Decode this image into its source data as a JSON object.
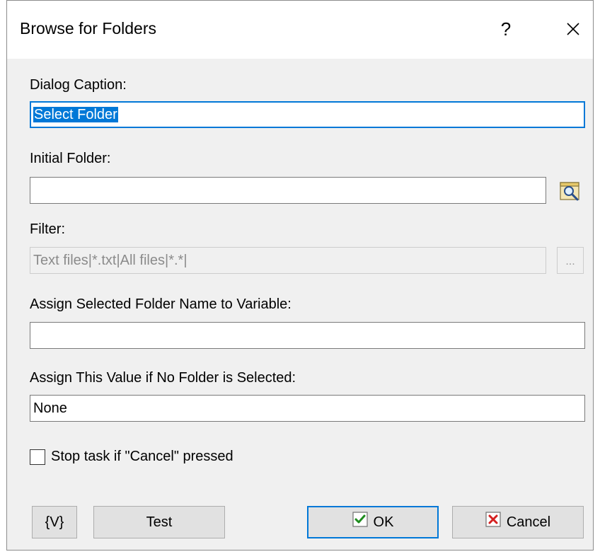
{
  "window": {
    "title": "Browse for Folders",
    "help_label": "?",
    "close_icon": "close-icon"
  },
  "fields": {
    "dialog_caption": {
      "label": "Dialog Caption:",
      "value": "Select Folder"
    },
    "initial_folder": {
      "label": "Initial Folder:",
      "value": "",
      "browse_icon": "browse-folder-icon"
    },
    "filter": {
      "label": "Filter:",
      "value": "Text files|*.txt|All files|*.*|",
      "button_label": "...",
      "disabled": true
    },
    "assign_variable": {
      "label": "Assign Selected Folder Name to Variable:",
      "value": ""
    },
    "no_folder_value": {
      "label": "Assign This Value if No Folder is Selected:",
      "value": "None"
    }
  },
  "options": {
    "stop_task_label": "Stop task if \"Cancel\" pressed",
    "stop_task_checked": false
  },
  "buttons": {
    "variables_label": "{V}",
    "test_label": "Test",
    "ok_label": "OK",
    "cancel_label": "Cancel",
    "ok_icon": "check-icon",
    "cancel_icon": "x-icon"
  },
  "colors": {
    "accent": "#0078d7",
    "dialog_bg": "#f0f0f0",
    "ok_check": "#1e8c1e",
    "cancel_x": "#d42020"
  }
}
